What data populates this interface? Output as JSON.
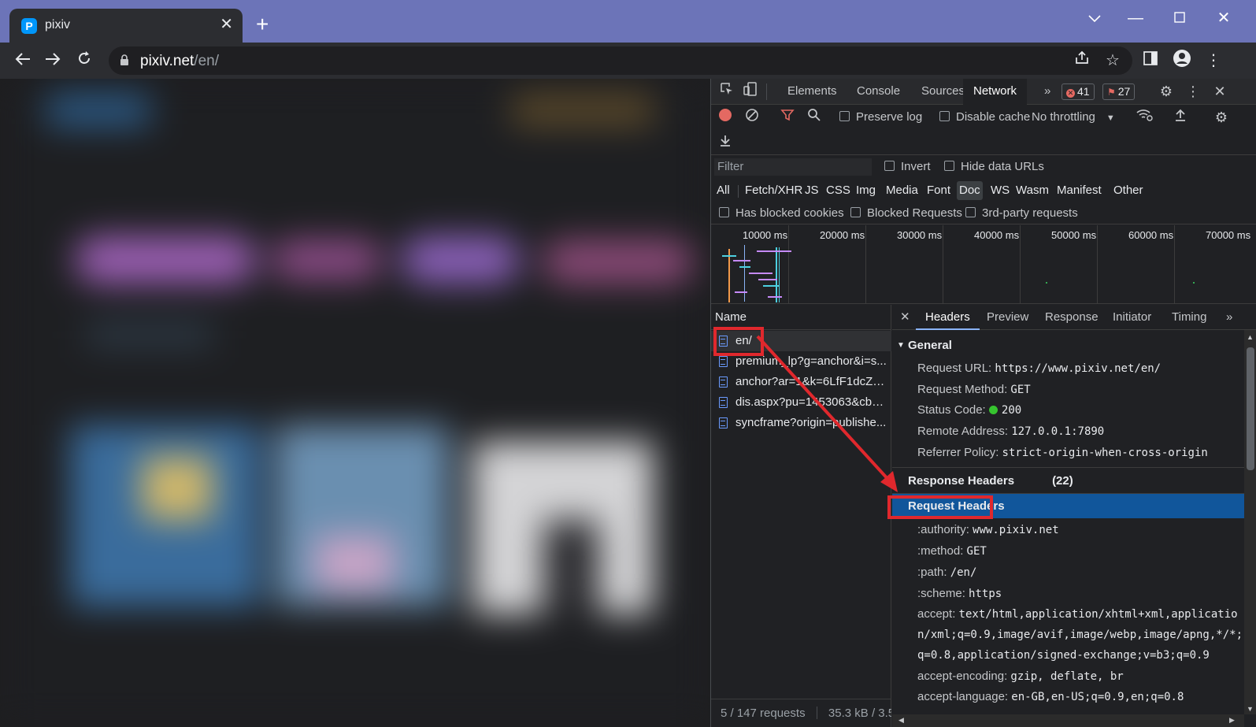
{
  "browser": {
    "tab_title": "pixiv",
    "favicon_letter": "P",
    "url_host": "pixiv.net",
    "url_path": "/en/"
  },
  "devtools": {
    "tabs": [
      "Elements",
      "Console",
      "Sources",
      "Network"
    ],
    "active_tab": "Network",
    "more_tabs": "»",
    "error_count": "41",
    "issue_count": "27",
    "network": {
      "preserve_log": "Preserve log",
      "disable_cache": "Disable cache",
      "throttling": "No throttling",
      "filter_placeholder": "Filter",
      "invert": "Invert",
      "hide_data_urls": "Hide data URLs",
      "types": [
        "All",
        "Fetch/XHR",
        "JS",
        "CSS",
        "Img",
        "Media",
        "Font",
        "Doc",
        "WS",
        "Wasm",
        "Manifest",
        "Other"
      ],
      "active_type": "Doc",
      "has_blocked_cookies": "Has blocked cookies",
      "blocked_requests": "Blocked Requests",
      "third_party": "3rd-party requests",
      "timeline_ticks": [
        "10000 ms",
        "20000 ms",
        "30000 ms",
        "40000 ms",
        "50000 ms",
        "60000 ms",
        "70000 ms"
      ],
      "name_header": "Name",
      "requests": [
        "en/",
        "premium_lp?g=anchor&i=s...",
        "anchor?ar=1&k=6LfF1dcZA...",
        "dis.aspx?pu=1453063&cb=...",
        "syncframe?origin=publishe..."
      ],
      "status_requests": "5 / 147 requests",
      "status_size": "35.3 kB / 3.5"
    },
    "details": {
      "tabs": [
        "Headers",
        "Preview",
        "Response",
        "Initiator",
        "Timing"
      ],
      "active_tab": "Headers",
      "general": {
        "title": "General",
        "request_url_label": "Request URL:",
        "request_url": "https://www.pixiv.net/en/",
        "request_method_label": "Request Method:",
        "request_method": "GET",
        "status_code_label": "Status Code:",
        "status_code": "200",
        "remote_address_label": "Remote Address:",
        "remote_address": "127.0.0.1:7890",
        "referrer_policy_label": "Referrer Policy:",
        "referrer_policy": "strict-origin-when-cross-origin"
      },
      "response_headers": {
        "title": "Response Headers",
        "count": "(22)"
      },
      "request_headers": {
        "title": "Request Headers",
        "authority_label": ":authority:",
        "authority": "www.pixiv.net",
        "method_label": ":method:",
        "method": "GET",
        "path_label": ":path:",
        "path": "/en/",
        "scheme_label": ":scheme:",
        "scheme": "https",
        "accept_label": "accept:",
        "accept_1": "text/html,application/xhtml+xml,applicatio",
        "accept_2": "n/xml;q=0.9,image/avif,image/webp,image/apng,*/*;",
        "accept_3": "q=0.8,application/signed-exchange;v=b3;q=0.9",
        "accept_encoding_label": "accept-encoding:",
        "accept_encoding": "gzip, deflate, br",
        "accept_language_label": "accept-language:",
        "accept_language": "en-GB,en-US;q=0.9,en;q=0.8"
      }
    }
  },
  "colors": {
    "titlebar": "#6c74b8",
    "annotation": "#e0282d",
    "selected_section": "#11569b",
    "status_ok": "#36c42f"
  }
}
